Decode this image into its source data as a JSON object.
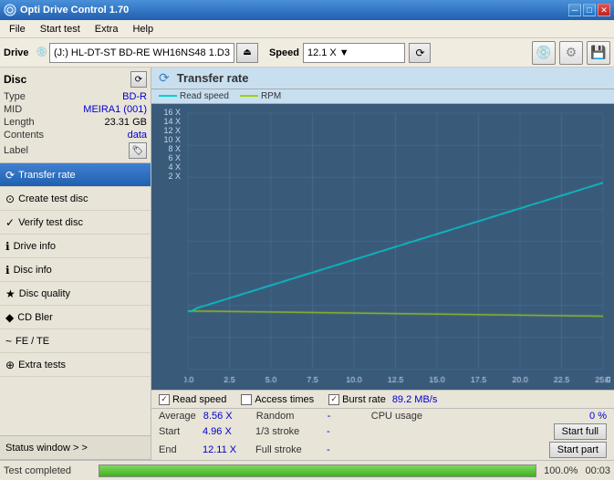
{
  "titleBar": {
    "title": "Opti Drive Control 1.70",
    "controls": [
      "_",
      "□",
      "✕"
    ]
  },
  "menuBar": {
    "items": [
      "File",
      "Start test",
      "Extra",
      "Help"
    ]
  },
  "driveBar": {
    "driveLabel": "Drive",
    "driveValue": "(J:)  HL-DT-ST BD-RE  WH16NS48 1.D3",
    "speedLabel": "Speed",
    "speedValue": "12.1 X  ▼"
  },
  "sidebar": {
    "discTitle": "Disc",
    "discInfo": {
      "type": {
        "key": "Type",
        "val": "BD-R"
      },
      "mid": {
        "key": "MID",
        "val": "MEIRA1 (001)"
      },
      "length": {
        "key": "Length",
        "val": "23.31 GB"
      },
      "contents": {
        "key": "Contents",
        "val": "data"
      },
      "label": {
        "key": "Label",
        "val": ""
      }
    },
    "navItems": [
      {
        "id": "transfer-rate",
        "label": "Transfer rate",
        "icon": "⟳",
        "active": true
      },
      {
        "id": "create-test-disc",
        "label": "Create test disc",
        "icon": "⊙",
        "active": false
      },
      {
        "id": "verify-test-disc",
        "label": "Verify test disc",
        "icon": "✓",
        "active": false
      },
      {
        "id": "drive-info",
        "label": "Drive info",
        "icon": "ℹ",
        "active": false
      },
      {
        "id": "disc-info",
        "label": "Disc info",
        "icon": "ℹ",
        "active": false
      },
      {
        "id": "disc-quality",
        "label": "Disc quality",
        "icon": "★",
        "active": false
      },
      {
        "id": "cd-bler",
        "label": "CD Bler",
        "icon": "◆",
        "active": false
      },
      {
        "id": "fe-te",
        "label": "FE / TE",
        "icon": "~",
        "active": false
      },
      {
        "id": "extra-tests",
        "label": "Extra tests",
        "icon": "⊕",
        "active": false
      }
    ],
    "statusWindow": "Status window > >"
  },
  "chart": {
    "title": "Transfer rate",
    "legend": {
      "readSpeed": "Read speed",
      "rpm": "RPM"
    },
    "yLabels": [
      "16 X",
      "14 X",
      "12 X",
      "10 X",
      "8 X",
      "6 X",
      "4 X",
      "2 X"
    ],
    "xLabels": [
      "0.0",
      "2.5",
      "5.0",
      "7.5",
      "10.0",
      "12.5",
      "15.0",
      "17.5",
      "20.0",
      "22.5",
      "25.0",
      "GB"
    ]
  },
  "checkboxes": {
    "readSpeed": {
      "label": "Read speed",
      "checked": true
    },
    "accessTimes": {
      "label": "Access times",
      "checked": false
    },
    "burstRate": {
      "label": "Burst rate",
      "checked": true,
      "value": "89.2 MB/s"
    }
  },
  "stats": {
    "average": {
      "label": "Average",
      "val": "8.56 X"
    },
    "random": {
      "label": "Random",
      "val": "-"
    },
    "cpuUsage": {
      "label": "CPU usage",
      "val": "0 %"
    },
    "start": {
      "label": "Start",
      "val": "4.96 X"
    },
    "oneThirdStroke": {
      "label": "1/3 stroke",
      "val": "-"
    },
    "startFullBtn": "Start full",
    "end": {
      "label": "End",
      "val": "12.11 X"
    },
    "fullStroke": {
      "label": "Full stroke",
      "val": "-"
    },
    "startPartBtn": "Start part"
  },
  "statusBar": {
    "text": "Test completed",
    "progress": 100.0,
    "progressLabel": "100.0%",
    "time": "00:03"
  }
}
